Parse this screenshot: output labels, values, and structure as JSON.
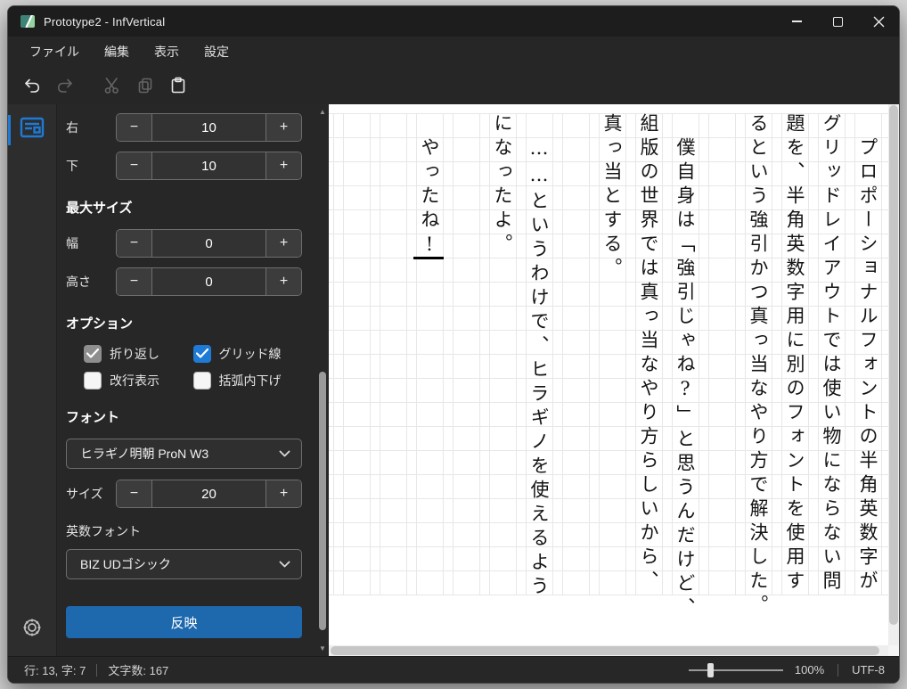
{
  "window": {
    "title": "Prototype2 - InfVertical"
  },
  "menubar": {
    "items": [
      {
        "label": "ファイル"
      },
      {
        "label": "編集"
      },
      {
        "label": "表示"
      },
      {
        "label": "設定"
      }
    ]
  },
  "toolbar": {
    "buttons": [
      {
        "icon": "undo-icon",
        "enabled": true
      },
      {
        "icon": "redo-icon",
        "enabled": false
      },
      {
        "icon": "cut-icon",
        "enabled": false
      },
      {
        "icon": "copy-icon",
        "enabled": false
      },
      {
        "icon": "paste-icon",
        "enabled": true
      }
    ]
  },
  "panel": {
    "margin_steppers": [
      {
        "label": "右",
        "value": "10",
        "minus": "−",
        "plus": "+"
      },
      {
        "label": "下",
        "value": "10",
        "minus": "−",
        "plus": "+"
      }
    ],
    "max_size": {
      "heading": "最大サイズ",
      "steppers": [
        {
          "label": "幅",
          "value": "0",
          "minus": "−",
          "plus": "+"
        },
        {
          "label": "高さ",
          "value": "0",
          "minus": "−",
          "plus": "+"
        }
      ]
    },
    "options": {
      "heading": "オプション",
      "checkboxes": [
        {
          "label": "折り返し",
          "checked": true,
          "disabled": true
        },
        {
          "label": "グリッド線",
          "checked": true,
          "disabled": false
        },
        {
          "label": "改行表示",
          "checked": false,
          "disabled": false
        },
        {
          "label": "括弧内下げ",
          "checked": false,
          "disabled": false
        }
      ]
    },
    "font": {
      "heading": "フォント",
      "family": "ヒラギノ明朝 ProN W3",
      "size_label": "サイズ",
      "size": {
        "label": "サイズ",
        "value": "20",
        "minus": "−",
        "plus": "+"
      },
      "latin_label": "英数フォント",
      "latin_family": "BIZ UDゴシック"
    },
    "apply_label": "反映"
  },
  "canvas": {
    "accent_color": "#1f7ad6",
    "grid_color": "#e7e7e7",
    "columns": [
      {
        "text": "プロポーショナルフォントの半角英数字が",
        "indent": true
      },
      {
        "text": "グリッドレイアウトでは使い物にならない問",
        "indent": false
      },
      {
        "text": "題を、半角英数字用に別のフォントを使用す",
        "indent": false
      },
      {
        "text": "るという強引かつ真っ当なやり方で解決した。",
        "indent": false
      },
      {
        "text": "",
        "indent": false
      },
      {
        "text": "僕自身は「強引じゃね?」と思うんだけど、",
        "indent": true
      },
      {
        "text": "組版の世界では真っ当なやり方らしいから、",
        "indent": false
      },
      {
        "text": "真っ当とする。",
        "indent": false
      },
      {
        "text": "",
        "indent": false
      },
      {
        "text": "……というわけで、ヒラギノを使えるよう",
        "indent": true
      },
      {
        "text": "になったよ。",
        "indent": false
      },
      {
        "text": "",
        "indent": false
      },
      {
        "text": "やったね!",
        "indent": true
      }
    ]
  },
  "statusbar": {
    "cursor_position": "行: 13, 字: 7",
    "char_count": "文字数: 167",
    "zoom": "100%",
    "encoding": "UTF-8"
  }
}
